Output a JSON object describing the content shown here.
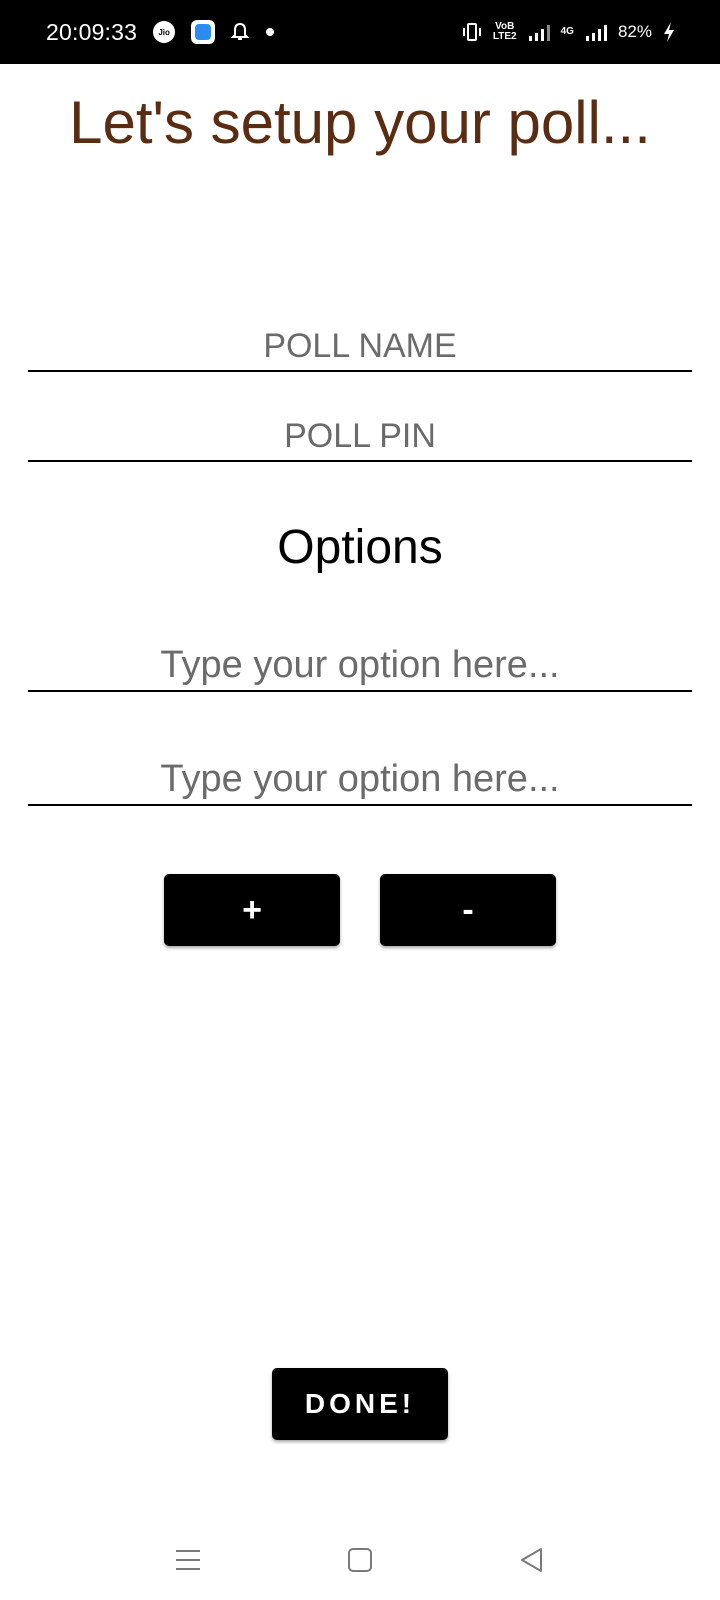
{
  "status_bar": {
    "time": "20:09:33",
    "network_top": "VoB",
    "network_bottom": "LTE2",
    "signal_label": "4G",
    "battery": "82%",
    "icons": [
      "jio-icon",
      "app-icon",
      "bell-icon",
      "dot-icon",
      "vibrate-icon",
      "signal-icon",
      "signal-icon",
      "charging-icon"
    ]
  },
  "title": "Let's setup your poll...",
  "form": {
    "poll_name_placeholder": "POLL NAME",
    "poll_pin_placeholder": "POLL PIN",
    "options_heading": "Options",
    "option_placeholder_1": "Type your option here...",
    "option_placeholder_2": "Type your option here...",
    "add_label": "+",
    "remove_label": "-",
    "done_label": "DONE!"
  },
  "nav_bar": {
    "icons": [
      "menu-icon",
      "home-icon",
      "back-icon"
    ]
  },
  "colors": {
    "title": "#5a2d12",
    "button": "#000000",
    "status_bar": "#000000"
  }
}
